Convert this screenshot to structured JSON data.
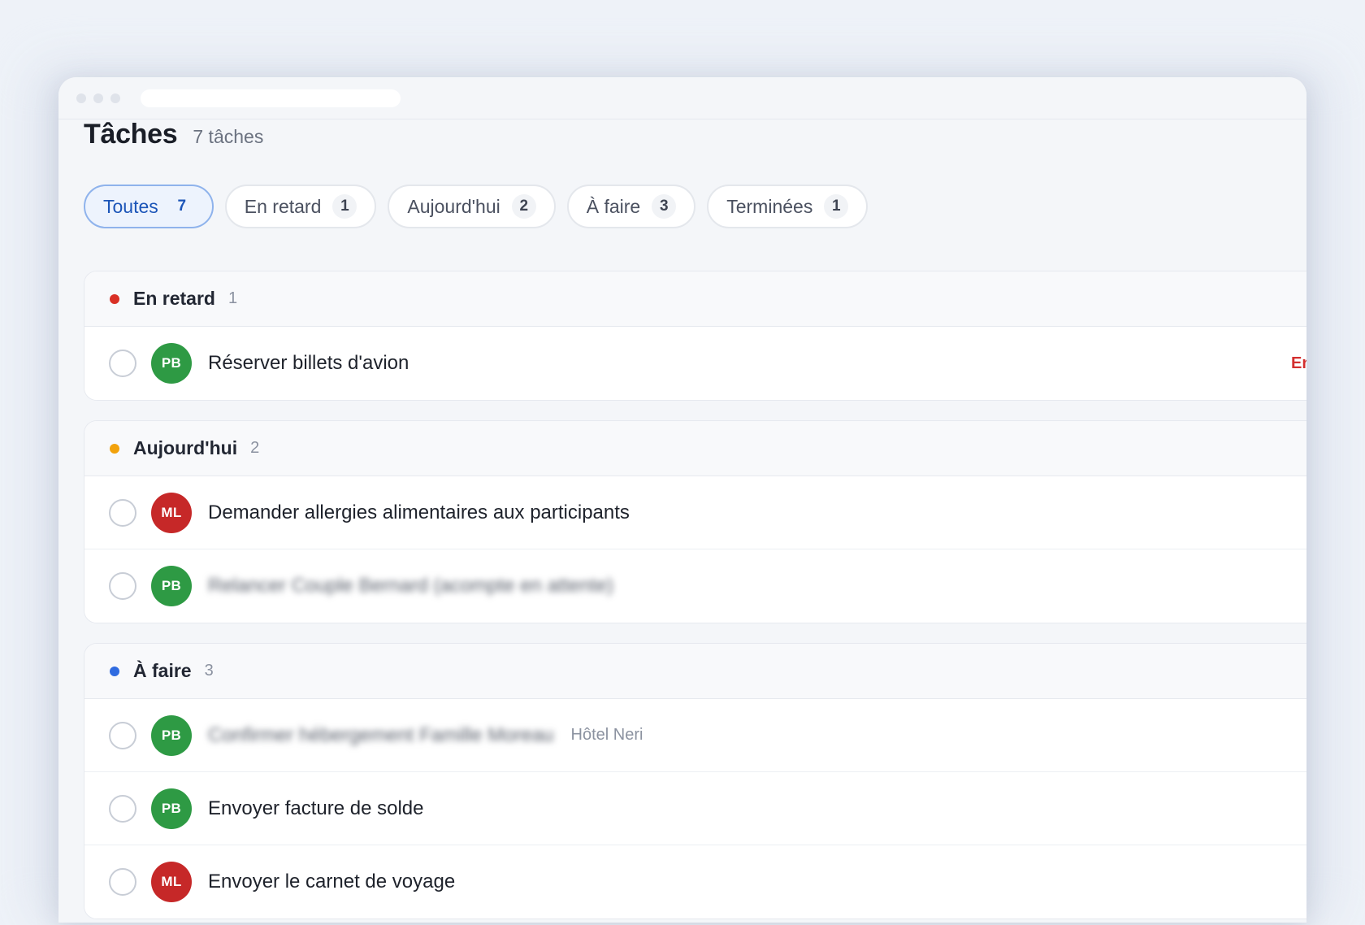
{
  "colors": {
    "overdue": "#d93025",
    "today": "#f2a20c",
    "todo": "#2f6be0",
    "avatar_pb": "#2e9a44",
    "avatar_ml": "#c62828",
    "accent": "#1c55b8"
  },
  "page": {
    "title": "Tâches",
    "count": "7 tâches"
  },
  "filters": [
    {
      "label": "Toutes",
      "count": "7",
      "active": true
    },
    {
      "label": "En retard",
      "count": "1"
    },
    {
      "label": "Aujourd'hui",
      "count": "2"
    },
    {
      "label": "À faire",
      "count": "3"
    },
    {
      "label": "Terminées",
      "count": "1"
    }
  ],
  "sections": {
    "overdue": {
      "title": "En retard",
      "count": "1",
      "tasks": [
        {
          "avatar": "PB",
          "text": "Réserver billets d'avion",
          "due": "En retard"
        }
      ]
    },
    "today": {
      "title": "Aujourd'hui",
      "count": "2",
      "tasks": [
        {
          "avatar": "ML",
          "text": "Demander allergies alimentaires aux participants"
        },
        {
          "avatar": "PB",
          "text": "Relancer Couple Bernard (acompte en attente)"
        }
      ]
    },
    "todo": {
      "title": "À faire",
      "count": "3",
      "tasks": [
        {
          "avatar": "PB",
          "text": "Confirmer hébergement Famille Moreau",
          "meta": "Hôtel Neri"
        },
        {
          "avatar": "PB",
          "text": "Envoyer facture de solde"
        },
        {
          "avatar": "ML",
          "text": "Envoyer le carnet de voyage"
        }
      ]
    }
  }
}
